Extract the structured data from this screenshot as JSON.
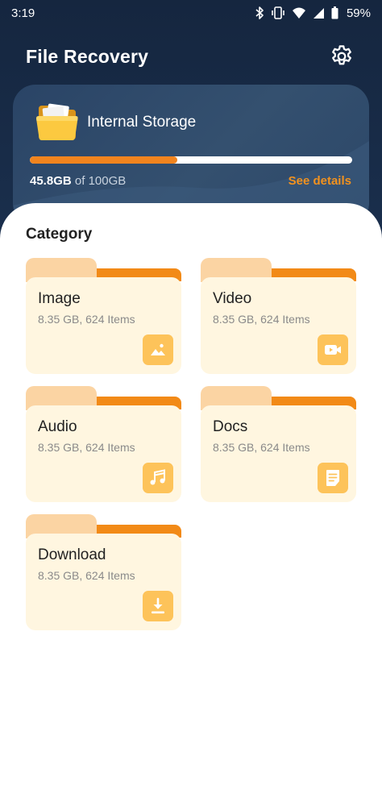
{
  "status_bar": {
    "time": "3:19",
    "battery_percent": "59%"
  },
  "app_bar": {
    "title": "File Recovery",
    "settings_icon": "gear-icon"
  },
  "storage": {
    "title": "Internal Storage",
    "icon": "folder-icon",
    "used": "45.8GB",
    "separator": " of ",
    "total": "100GB",
    "used_fraction": 0.458,
    "see_details_label": "See details"
  },
  "category": {
    "title": "Category",
    "items": [
      {
        "name": "Image",
        "meta": "8.35 GB, 624 Items",
        "icon": "image-icon"
      },
      {
        "name": "Video",
        "meta": "8.35 GB, 624 Items",
        "icon": "video-icon"
      },
      {
        "name": "Audio",
        "meta": "8.35 GB, 624 Items",
        "icon": "music-icon"
      },
      {
        "name": "Docs",
        "meta": "8.35 GB, 624 Items",
        "icon": "document-icon"
      },
      {
        "name": "Download",
        "meta": "8.35 GB, 624 Items",
        "icon": "download-icon"
      }
    ]
  },
  "colors": {
    "header_bg": "#15263f",
    "accent_orange": "#f2841e",
    "folder_tab": "#fbd4a3",
    "folder_body": "#fff6e0",
    "icon_tile": "#fdc35a"
  }
}
